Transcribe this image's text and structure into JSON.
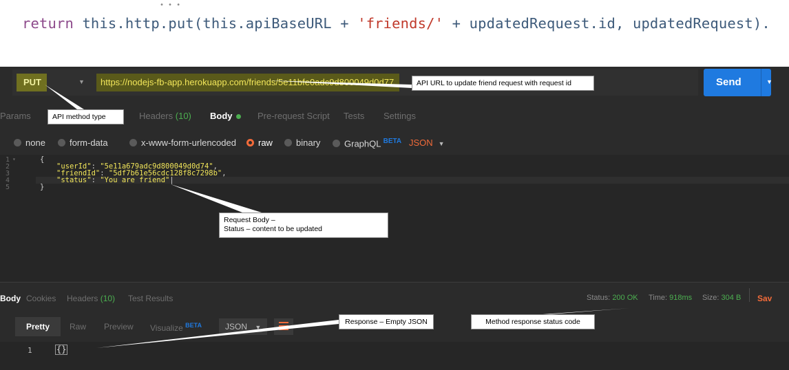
{
  "code_snippet": {
    "kw_return": "return",
    "part1": " this.http.put(this.apiBaseURL + ",
    "str": "'friends/'",
    "part2": " + updatedRequest.id, updatedRequest)."
  },
  "request": {
    "method": "PUT",
    "url": "https://nodejs-fb-app.herokuapp.com/friends/5e11bfe0adc9d800049d0d77",
    "send_label": "Send"
  },
  "request_tabs": {
    "params": "Params",
    "headers": "Headers",
    "headers_count": "(10)",
    "body": "Body",
    "pre_request": "Pre-request Script",
    "tests": "Tests",
    "settings": "Settings"
  },
  "body_types": {
    "none": "none",
    "form_data": "form-data",
    "urlencoded": "x-www-form-urlencoded",
    "raw": "raw",
    "binary": "binary",
    "graphql": "GraphQL",
    "graphql_badge": "BETA",
    "format": "JSON"
  },
  "editor": {
    "line_numbers": [
      "1",
      "2",
      "3",
      "4",
      "5"
    ],
    "open": "{",
    "close": "}",
    "fields": [
      {
        "key": "\"userId\"",
        "value": "\"5e11a679adc9d800049d0d74\"",
        "trail": ","
      },
      {
        "key": "\"friendId\"",
        "value": "\"5df7b61e56cdc128f8c7298b\"",
        "trail": ","
      },
      {
        "key": "\"status\"",
        "value": "\"You are friend\"",
        "trail": ""
      }
    ]
  },
  "response_tabs": {
    "body": "Body",
    "cookies": "Cookies",
    "headers": "Headers",
    "headers_count": "(10)",
    "test_results": "Test Results"
  },
  "response_status": {
    "status_label": "Status:",
    "status_value": "200 OK",
    "time_label": "Time:",
    "time_value": "918ms",
    "size_label": "Size:",
    "size_value": "304 B",
    "save": "Sav"
  },
  "view_modes": {
    "pretty": "Pretty",
    "raw": "Raw",
    "preview": "Preview",
    "visualize": "Visualize",
    "visualize_badge": "BETA",
    "format": "JSON"
  },
  "response_body": {
    "line_number": "1",
    "content": "{}"
  },
  "annotations": {
    "url": "API URL to update friend request with request id",
    "method": "API method type",
    "request_body_line1": "Request Body –",
    "request_body_line2": "Status – content to be updated",
    "response": "Response – Empty JSON",
    "status_code": "Method response status code"
  },
  "colors": {
    "panel_bg": "#2b2b2b",
    "send_button": "#1f7ae0",
    "accent_orange": "#f26b3a",
    "status_green": "#4caf50",
    "highlight_yellow": "#f2e65a"
  }
}
